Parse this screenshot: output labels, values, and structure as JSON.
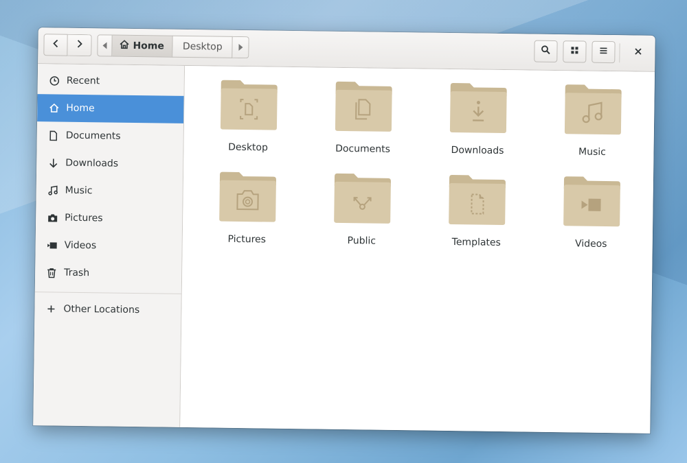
{
  "toolbar": {
    "back_icon": "go-back-icon",
    "forward_icon": "go-forward-icon",
    "search_icon": "search-icon",
    "view_icon": "grid-view-icon",
    "menu_icon": "menu-icon",
    "close_icon": "close-icon"
  },
  "pathbar": {
    "home_label": "Home",
    "current_label": "Desktop"
  },
  "sidebar": {
    "items": [
      {
        "label": "Recent",
        "icon": "clock-icon"
      },
      {
        "label": "Home",
        "icon": "home-icon",
        "active": true
      },
      {
        "label": "Documents",
        "icon": "document-icon"
      },
      {
        "label": "Downloads",
        "icon": "download-icon"
      },
      {
        "label": "Music",
        "icon": "music-icon"
      },
      {
        "label": "Pictures",
        "icon": "camera-icon"
      },
      {
        "label": "Videos",
        "icon": "video-icon"
      },
      {
        "label": "Trash",
        "icon": "trash-icon"
      }
    ],
    "other_locations": {
      "label": "Other Locations",
      "icon": "plus-icon"
    }
  },
  "folders": [
    {
      "label": "Desktop",
      "icon": "desktop-folder-icon"
    },
    {
      "label": "Documents",
      "icon": "documents-folder-icon"
    },
    {
      "label": "Downloads",
      "icon": "downloads-folder-icon"
    },
    {
      "label": "Music",
      "icon": "music-folder-icon"
    },
    {
      "label": "Pictures",
      "icon": "pictures-folder-icon"
    },
    {
      "label": "Public",
      "icon": "public-folder-icon"
    },
    {
      "label": "Templates",
      "icon": "templates-folder-icon"
    },
    {
      "label": "Videos",
      "icon": "videos-folder-icon"
    }
  ],
  "colors": {
    "accent": "#4a90d9",
    "folder": "#d8c9a9",
    "folder_tab": "#c9b894",
    "folder_glyph": "#b5a27e"
  }
}
